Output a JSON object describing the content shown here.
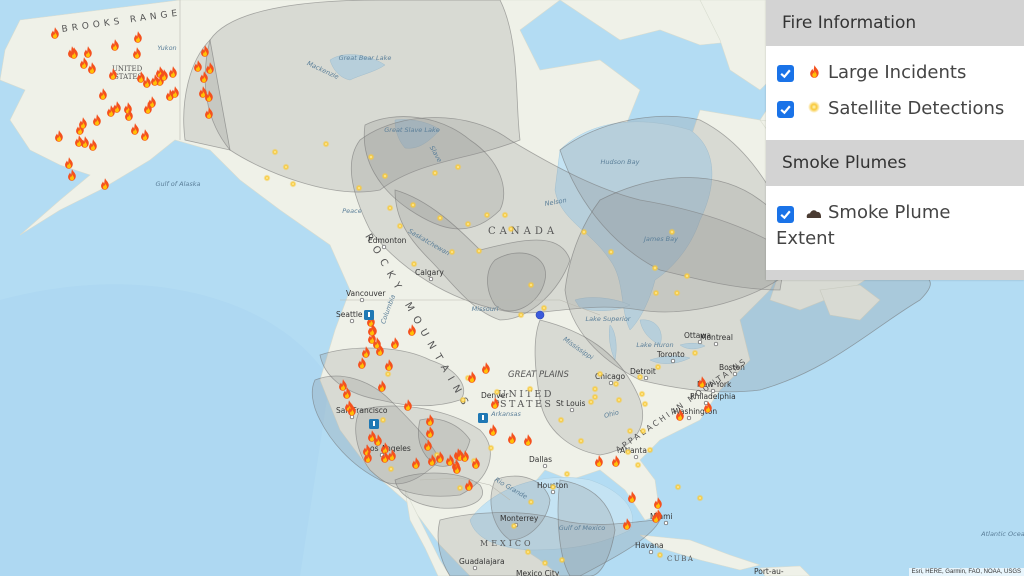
{
  "legend": {
    "fire_section_title": "Fire Information",
    "items": [
      {
        "label": "Large Incidents",
        "checked": true,
        "icon": "flame-icon"
      },
      {
        "label": "Satellite Detections",
        "checked": true,
        "icon": "satellite-dot-icon"
      }
    ],
    "smoke_section_title": "Smoke Plumes",
    "smoke_items": [
      {
        "label": "Smoke Plume Extent",
        "checked": true,
        "icon": "smoke-cloud-icon"
      }
    ]
  },
  "map": {
    "region_labels": [
      "BROOKS RANGE",
      "UNITED STATES",
      "CANADA",
      "ROCKY MOUNTAINS",
      "GREAT PLAINS",
      "UNITED STATES",
      "APPALACHIAN MOUNTAINS",
      "MEXICO",
      "CUBA"
    ],
    "region_label_list": {
      "brooks": "BROOKS RANGE",
      "alaska": "UNITED STATES",
      "canada": "CANADA",
      "rocky": "ROCKY MOUNTAINS",
      "plains": "GREAT PLAINS",
      "us1": "UNITED",
      "us2": "STATES",
      "appalachian": "APPALACHIAN MOUNTAINS",
      "mexico": "MEXICO",
      "cuba": "CUBA"
    },
    "water_labels": {
      "gulf_alaska": "Gulf of Alaska",
      "great_bear": "Great Bear Lake",
      "great_slave": "Great Slave Lake",
      "hudson": "Hudson Bay",
      "james": "James Bay",
      "superior": "Lake Superior",
      "huron": "Lake Huron",
      "gulf_mexico": "Gulf of Mexico",
      "atlantic": "Atlantic Ocean",
      "yukon": "Yukon",
      "mackenzie": "Mackenzie",
      "slave": "Slave",
      "peace": "Peace",
      "saskatchewan": "Saskatchewan",
      "missouri": "Missouri",
      "mississippi": "Mississippi",
      "ohio": "Ohio",
      "arkansas": "Arkansas",
      "columbia": "Columbia",
      "rio_grande": "Rio Grande",
      "nelson": "Nelson"
    },
    "cities": [
      {
        "name": "Edmonton"
      },
      {
        "name": "Calgary"
      },
      {
        "name": "Vancouver"
      },
      {
        "name": "Seattle"
      },
      {
        "name": "San Francisco"
      },
      {
        "name": "Los Angeles"
      },
      {
        "name": "Denver"
      },
      {
        "name": "Dallas"
      },
      {
        "name": "Houston"
      },
      {
        "name": "Monterrey"
      },
      {
        "name": "Guadalajara"
      },
      {
        "name": "Mexico City"
      },
      {
        "name": "Chicago"
      },
      {
        "name": "St Louis"
      },
      {
        "name": "Detroit"
      },
      {
        "name": "Toronto"
      },
      {
        "name": "Ottawa"
      },
      {
        "name": "Montreal"
      },
      {
        "name": "Boston"
      },
      {
        "name": "New York"
      },
      {
        "name": "Philadelphia"
      },
      {
        "name": "Washington"
      },
      {
        "name": "Atlanta"
      },
      {
        "name": "Miami"
      },
      {
        "name": "Havana"
      },
      {
        "name": "Port-au-"
      }
    ],
    "attribution": "Esri, HERE, Garmin, FAO, NOAA, USGS"
  },
  "colors": {
    "ocean": "#b3dcf3",
    "land": "#eef0e6",
    "smoke_fill": "#8a8a8a",
    "checkbox": "#1a73e8",
    "legend_header": "#d3d3d3",
    "fire": "#f05a14",
    "satellite": "#f6c23c",
    "marker_blue": "#3b5bdb",
    "incident_marker": "#1f78b4"
  }
}
